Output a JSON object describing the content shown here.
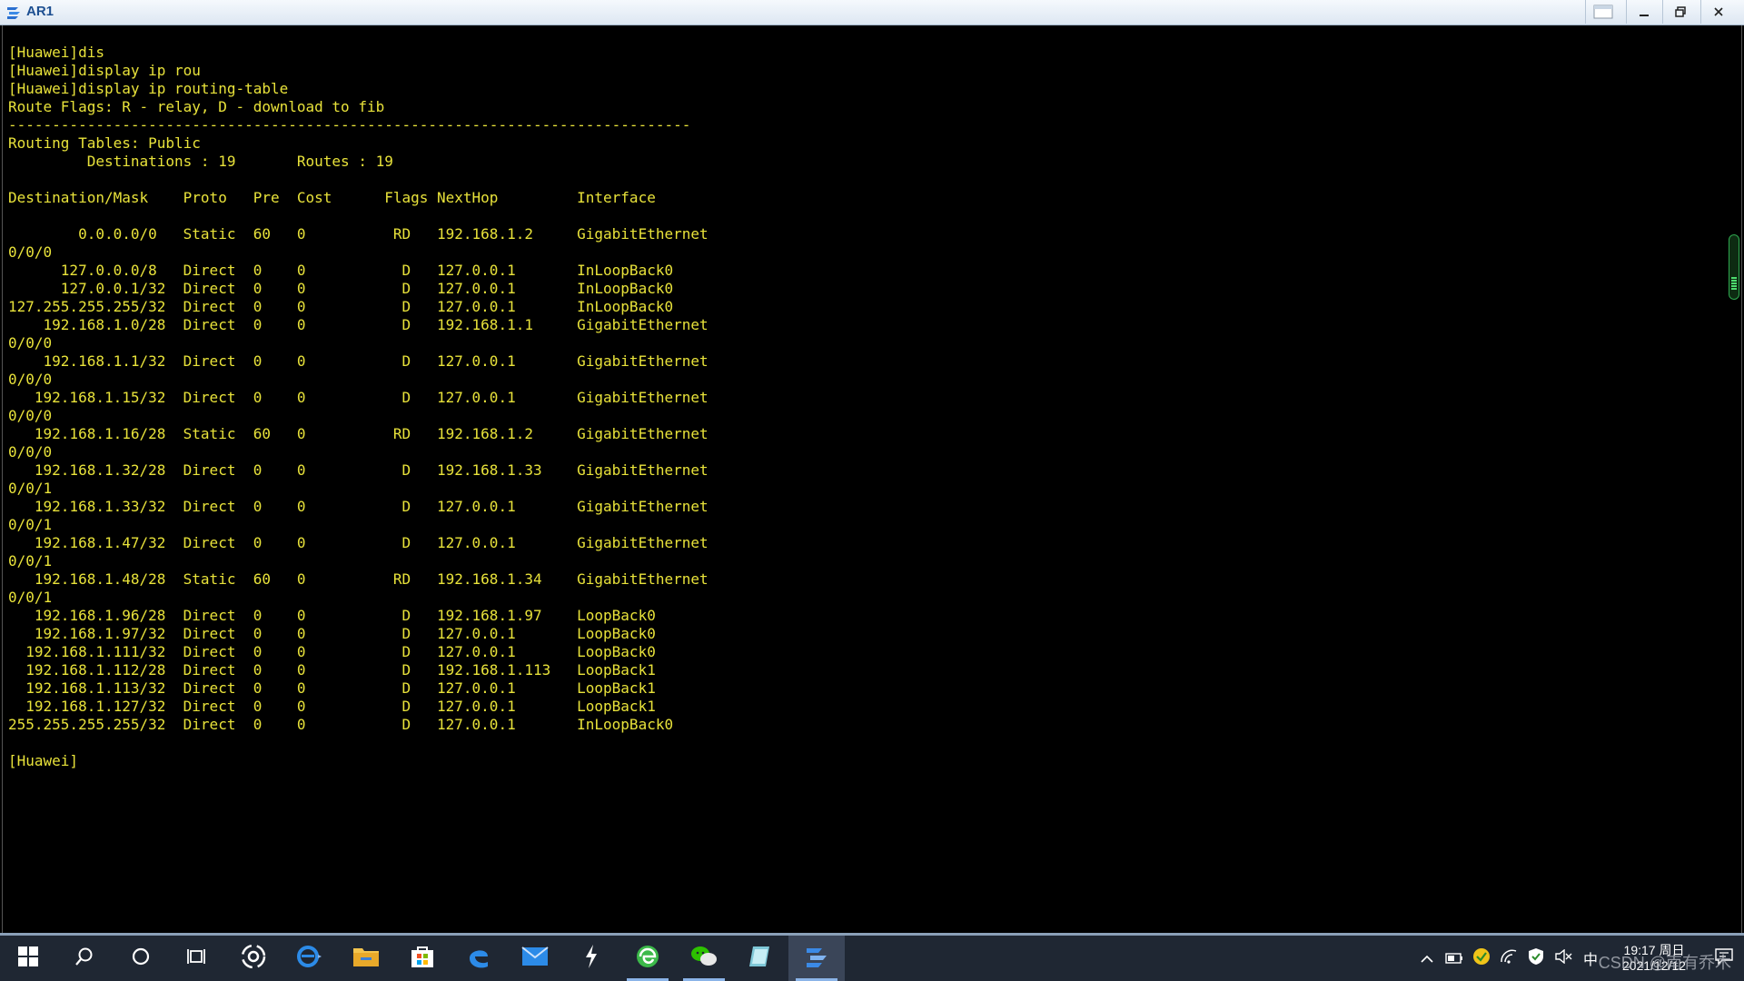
{
  "window": {
    "title": "AR1"
  },
  "terminal": {
    "lines": [
      "[Huawei]dis",
      "[Huawei]display ip rou",
      "[Huawei]display ip routing-table",
      "Route Flags: R - relay, D - download to fib",
      "------------------------------------------------------------------------------",
      "Routing Tables: Public",
      "         Destinations : 19       Routes : 19",
      "",
      "Destination/Mask    Proto   Pre  Cost      Flags NextHop         Interface",
      "",
      "        0.0.0.0/0   Static  60   0          RD   192.168.1.2     GigabitEthernet",
      "0/0/0",
      "      127.0.0.0/8   Direct  0    0           D   127.0.0.1       InLoopBack0",
      "      127.0.0.1/32  Direct  0    0           D   127.0.0.1       InLoopBack0",
      "127.255.255.255/32  Direct  0    0           D   127.0.0.1       InLoopBack0",
      "    192.168.1.0/28  Direct  0    0           D   192.168.1.1     GigabitEthernet",
      "0/0/0",
      "    192.168.1.1/32  Direct  0    0           D   127.0.0.1       GigabitEthernet",
      "0/0/0",
      "   192.168.1.15/32  Direct  0    0           D   127.0.0.1       GigabitEthernet",
      "0/0/0",
      "   192.168.1.16/28  Static  60   0          RD   192.168.1.2     GigabitEthernet",
      "0/0/0",
      "   192.168.1.32/28  Direct  0    0           D   192.168.1.33    GigabitEthernet",
      "0/0/1",
      "   192.168.1.33/32  Direct  0    0           D   127.0.0.1       GigabitEthernet",
      "0/0/1",
      "   192.168.1.47/32  Direct  0    0           D   127.0.0.1       GigabitEthernet",
      "0/0/1",
      "   192.168.1.48/28  Static  60   0          RD   192.168.1.34    GigabitEthernet",
      "0/0/1",
      "   192.168.1.96/28  Direct  0    0           D   192.168.1.97    LoopBack0",
      "   192.168.1.97/32  Direct  0    0           D   127.0.0.1       LoopBack0",
      "  192.168.1.111/32  Direct  0    0           D   127.0.0.1       LoopBack0",
      "  192.168.1.112/28  Direct  0    0           D   192.168.1.113   LoopBack1",
      "  192.168.1.113/32  Direct  0    0           D   127.0.0.1       LoopBack1",
      "  192.168.1.127/32  Direct  0    0           D   127.0.0.1       LoopBack1",
      "255.255.255.255/32  Direct  0    0           D   127.0.0.1       InLoopBack0",
      "",
      "[Huawei]"
    ]
  },
  "taskbar": {
    "clock_time": "19:17 周日",
    "clock_date": "2021/12/12",
    "ime_label": "中"
  },
  "watermark": "CSDN @南有乔木",
  "colors": {
    "terminal_text": "#e8e23a",
    "terminal_bg": "#000000",
    "taskbar_bg": "#1f2733"
  }
}
